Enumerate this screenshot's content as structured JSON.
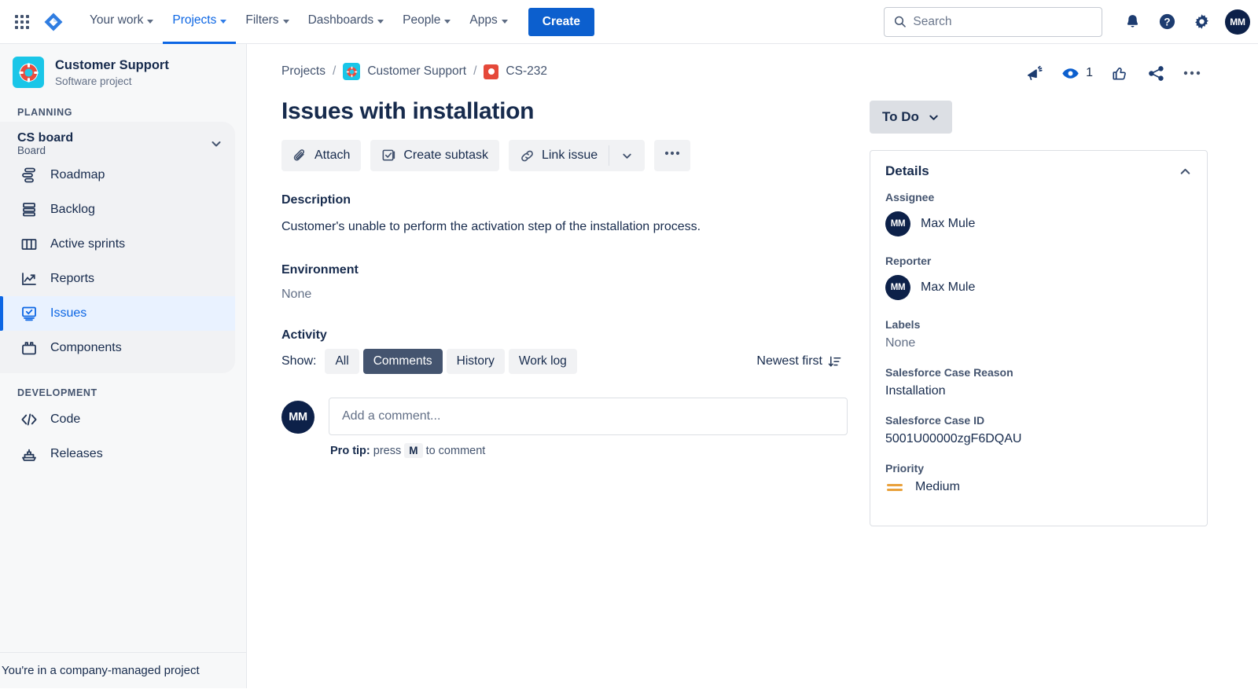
{
  "nav": {
    "links": [
      {
        "label": "Your work",
        "has_chevron": true,
        "active": false
      },
      {
        "label": "Projects",
        "has_chevron": true,
        "active": true
      },
      {
        "label": "Filters",
        "has_chevron": true,
        "active": false
      },
      {
        "label": "Dashboards",
        "has_chevron": true,
        "active": false
      },
      {
        "label": "People",
        "has_chevron": true,
        "active": false
      },
      {
        "label": "Apps",
        "has_chevron": true,
        "active": false
      }
    ],
    "create_label": "Create",
    "search_placeholder": "Search",
    "search_value": "",
    "avatar_initials": "MM"
  },
  "sidebar": {
    "project_name": "Customer Support",
    "project_type": "Software project",
    "planning_label": "PLANNING",
    "board_name": "CS board",
    "board_sub": "Board",
    "planning_items": [
      {
        "label": "Roadmap",
        "icon": "roadmap-icon",
        "selected": false
      },
      {
        "label": "Backlog",
        "icon": "backlog-icon",
        "selected": false
      },
      {
        "label": "Active sprints",
        "icon": "board-columns-icon",
        "selected": false
      },
      {
        "label": "Reports",
        "icon": "reports-chart-icon",
        "selected": false
      },
      {
        "label": "Issues",
        "icon": "issues-icon",
        "selected": true
      },
      {
        "label": "Components",
        "icon": "components-icon",
        "selected": false
      }
    ],
    "development_label": "DEVELOPMENT",
    "development_items": [
      {
        "label": "Code",
        "icon": "code-icon",
        "selected": false
      },
      {
        "label": "Releases",
        "icon": "releases-ship-icon",
        "selected": false
      }
    ],
    "footer_text": "You're in a company-managed project"
  },
  "issue": {
    "breadcrumb": {
      "projects": "Projects",
      "project": "Customer Support",
      "key": "CS-232"
    },
    "title": "Issues with installation",
    "header_actions": {
      "watch_count": "1"
    },
    "buttons": {
      "attach": "Attach",
      "create_subtask": "Create subtask",
      "link_issue": "Link issue"
    },
    "description": {
      "heading": "Description",
      "text": "Customer's unable to perform the activation step of the installation process."
    },
    "environment": {
      "heading": "Environment",
      "value": "None"
    },
    "activity": {
      "heading": "Activity",
      "show_label": "Show:",
      "filters": [
        {
          "label": "All",
          "active": false
        },
        {
          "label": "Comments",
          "active": true
        },
        {
          "label": "History",
          "active": false
        },
        {
          "label": "Work log",
          "active": false
        }
      ],
      "sort_label": "Newest first"
    },
    "comment": {
      "avatar_initials": "MM",
      "placeholder": "Add a comment...",
      "value": "",
      "protip_prefix": "Pro tip:",
      "protip_mid": "press",
      "protip_key": "M",
      "protip_suffix": "to comment"
    }
  },
  "details": {
    "status": "To Do",
    "panel_title": "Details",
    "fields": [
      {
        "label": "Assignee",
        "value": "Max Mule",
        "type": "user",
        "initials": "MM"
      },
      {
        "label": "Reporter",
        "value": "Max Mule",
        "type": "user",
        "initials": "MM"
      },
      {
        "label": "Labels",
        "value": "None",
        "type": "muted"
      },
      {
        "label": "Salesforce Case Reason",
        "value": "Installation",
        "type": "text"
      },
      {
        "label": "Salesforce Case ID",
        "value": "5001U00000zgF6DQAU",
        "type": "text"
      },
      {
        "label": "Priority",
        "value": "Medium",
        "type": "priority"
      }
    ]
  },
  "colors": {
    "brand_blue": "#0c66e4",
    "create_blue": "#0c5fce",
    "project_cyan": "#1ac6e8",
    "bug_red": "#e5493a",
    "avatar_navy": "#0d2149",
    "priority_medium": "#e9a13b",
    "selected_nav_bg": "#e9f2ff",
    "active_filter_bg": "#44546f"
  }
}
